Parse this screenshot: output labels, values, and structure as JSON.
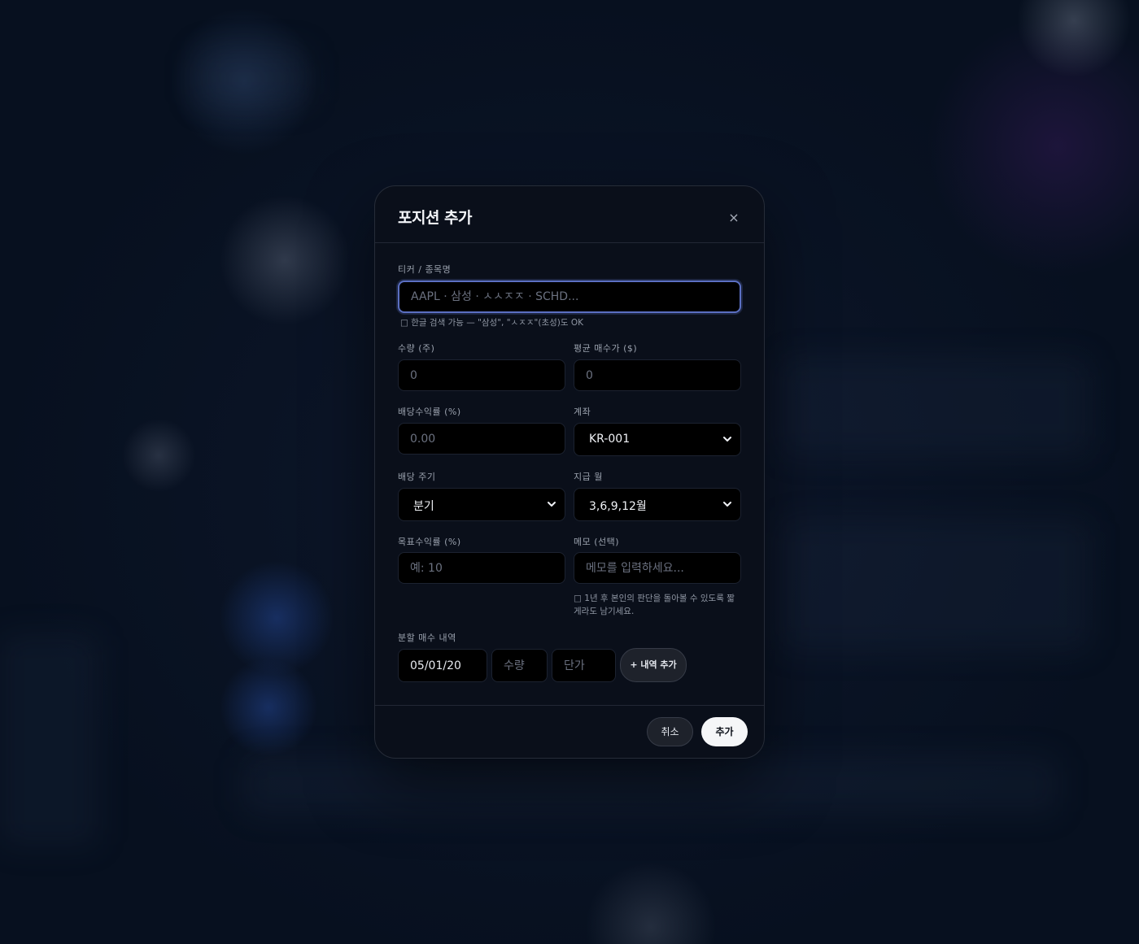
{
  "modal": {
    "title": "포지션 추가",
    "close_label": "×"
  },
  "ticker": {
    "label": "티커 / 종목명",
    "placeholder": "AAPL · 삼성 · ㅅㅅㅈㅈ · SCHD...",
    "hint": "□ 한글 검색 가능 — \"삼성\", \"ㅅㅈㅈ\"(초성)도 OK"
  },
  "quantity": {
    "label": "수량 (주)",
    "placeholder": "0"
  },
  "avg_price": {
    "label": "평균 매수가 ($)",
    "placeholder": "0"
  },
  "dividend_yield": {
    "label": "배당수익률 (%)",
    "placeholder": "0.00"
  },
  "account": {
    "label": "계좌",
    "value": "KR-001"
  },
  "dividend_cycle": {
    "label": "배당 주기",
    "value": "분기"
  },
  "pay_month": {
    "label": "지급 월",
    "value": "3,6,9,12월"
  },
  "target_return": {
    "label": "목표수익률 (%)",
    "placeholder": "예: 10"
  },
  "memo": {
    "label": "메모 (선택)",
    "placeholder": "메모를 입력하세요...",
    "hint": "□ 1년 후 본인의 판단을 돌아볼 수 있도록 짧게라도 남기세요."
  },
  "split_buy": {
    "label": "분할 매수 내역",
    "date_value": "05/01/20",
    "qty_placeholder": "수량",
    "price_placeholder": "단가",
    "add_label": "+ 내역 추가"
  },
  "footer": {
    "cancel_label": "취소",
    "submit_label": "추가"
  }
}
